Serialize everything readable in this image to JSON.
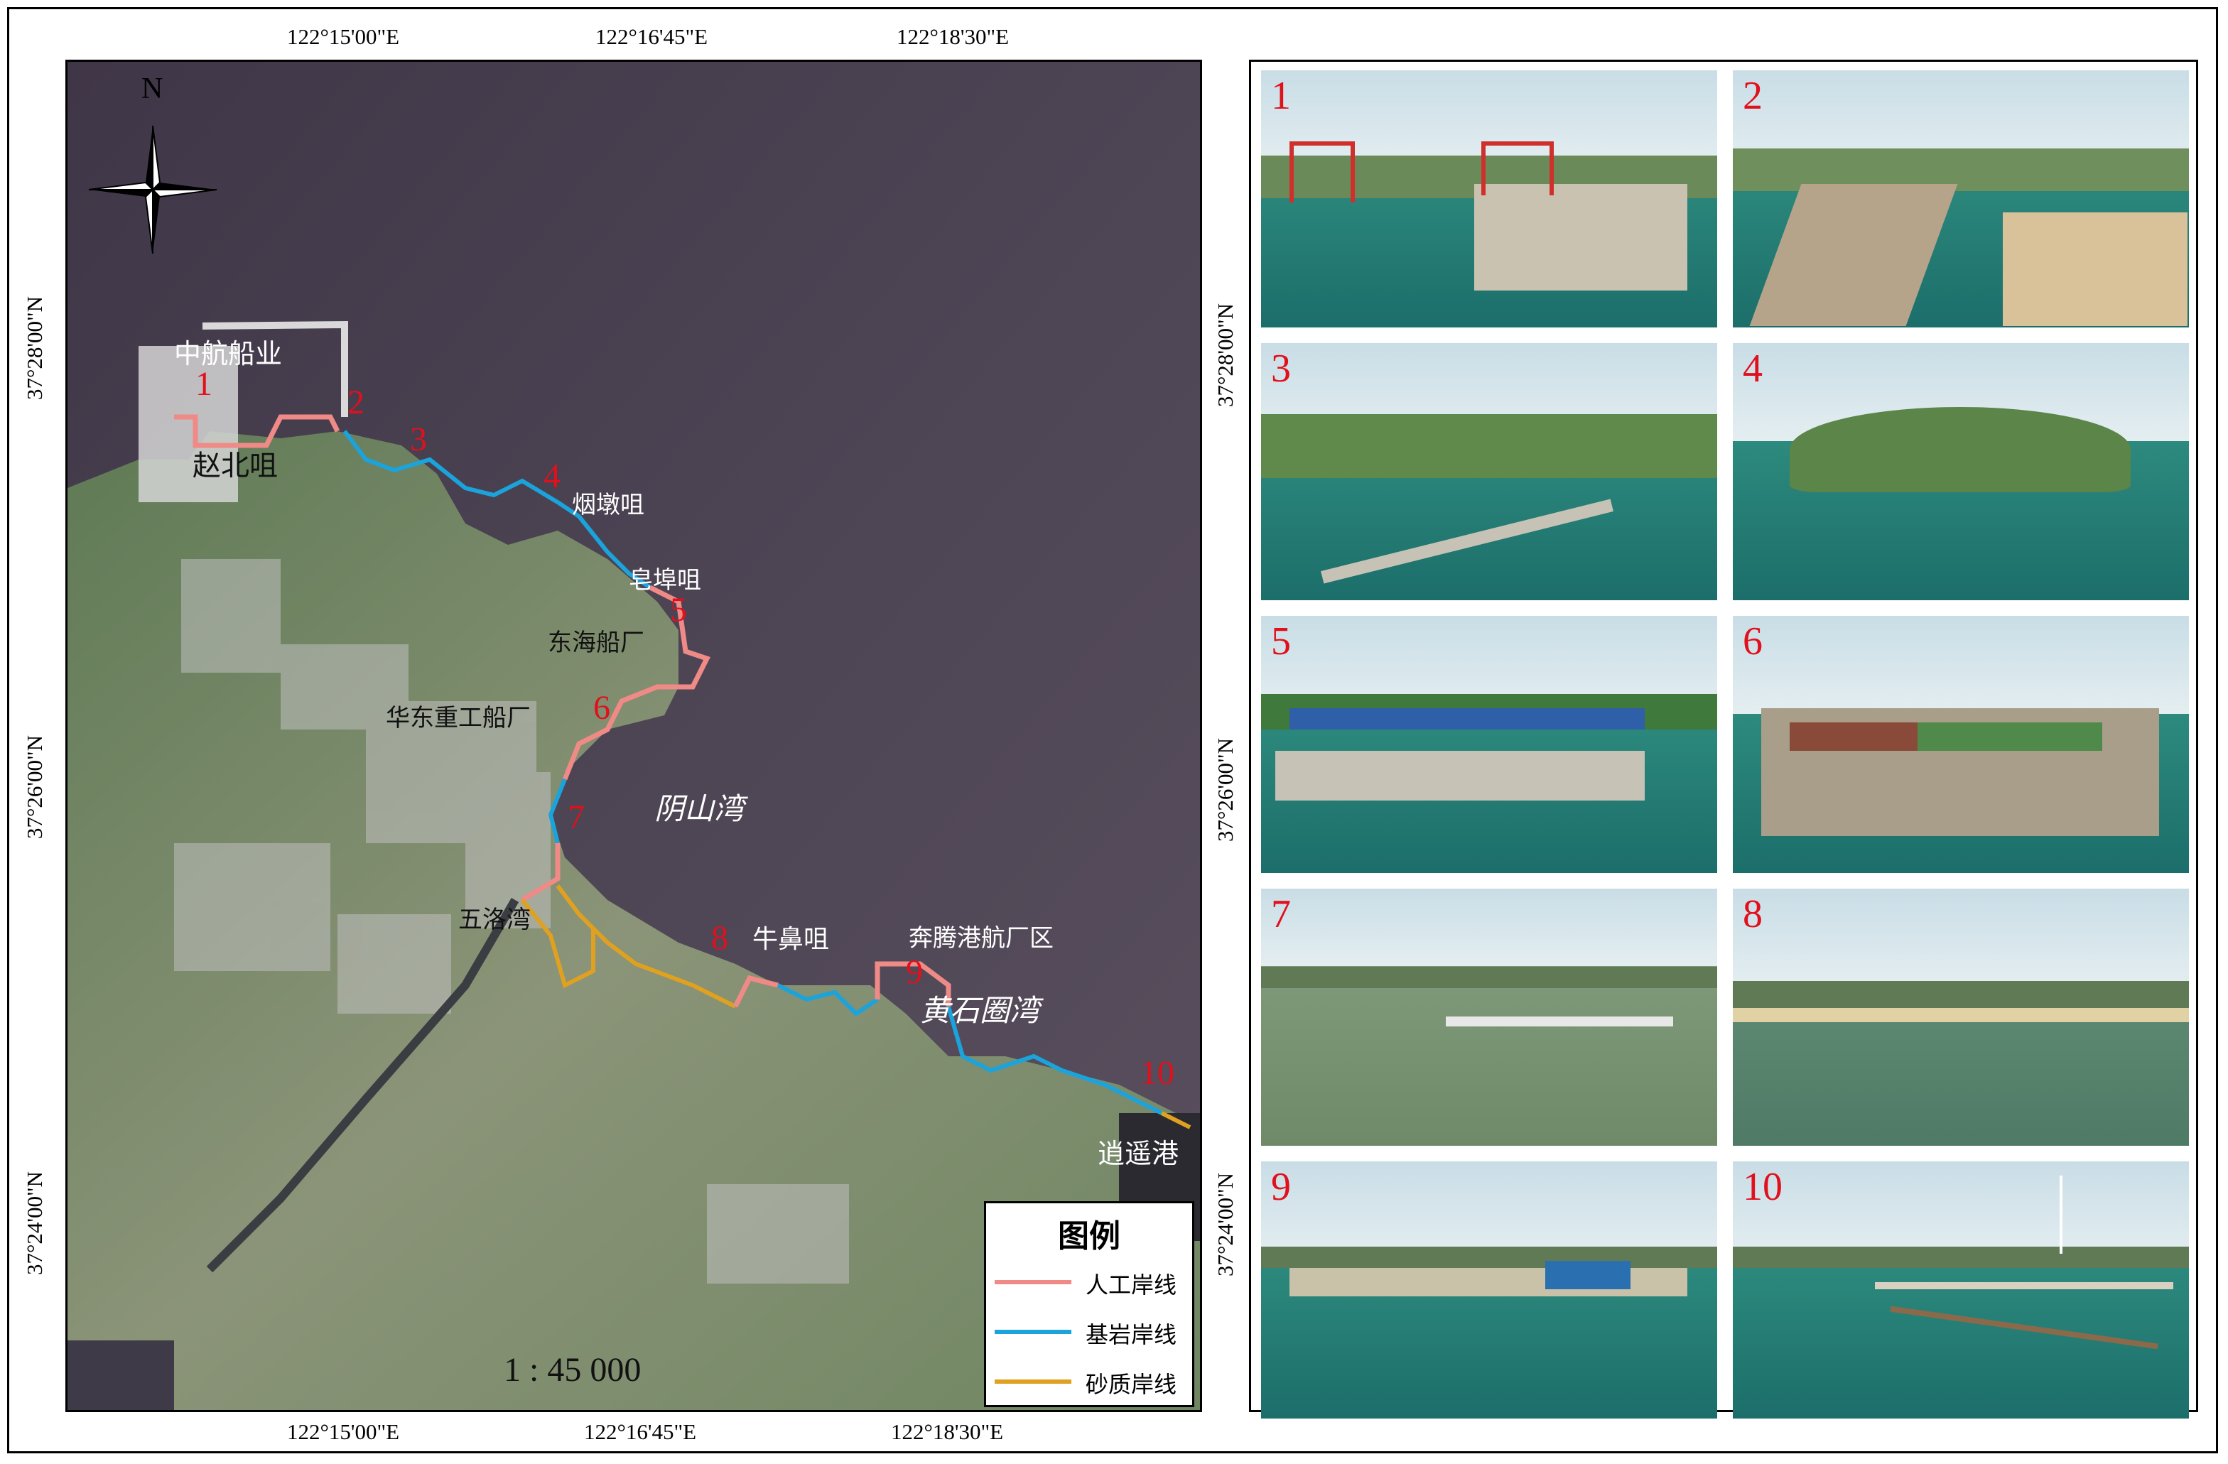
{
  "top_lon_labels": [
    "122°15'00\"E",
    "122°16'45\"E",
    "122°18'30\"E"
  ],
  "bottom_lon_labels": [
    "122°15'00\"E",
    "122°16'45\"E",
    "122°18'30\"E"
  ],
  "left_lat_labels": [
    "37°28'00\"N",
    "37°26'00\"N",
    "37°24'00\"N"
  ],
  "right_lat_labels": [
    "37°28'00\"N",
    "37°26'00\"N",
    "37°24'00\"N"
  ],
  "north_label": "N",
  "place_labels": {
    "zhonghang": "中航船业",
    "zhaobeizui": "赵北咀",
    "yandunzui": "烟墩咀",
    "huangbuzui": "皂埠咀",
    "donghai": "东海船厂",
    "huadong": "华东重工船厂",
    "yinshanwan": "阴山湾",
    "wulei": "五洛湾",
    "niubizui": "牛鼻咀",
    "benteng": "奔腾港航厂区",
    "huangshiquan": "黄石圈湾",
    "xiaoyao": "逍遥港"
  },
  "map_numbers": [
    "1",
    "2",
    "3",
    "4",
    "5",
    "6",
    "7",
    "8",
    "9",
    "10"
  ],
  "legend": {
    "title": "图例",
    "items": [
      {
        "label": "人工岸线",
        "color": "#f08a86"
      },
      {
        "label": "基岩岸线",
        "color": "#1ba3dc"
      },
      {
        "label": "砂质岸线",
        "color": "#e0a020"
      }
    ]
  },
  "scale": "1 : 45 000",
  "photo_numbers": [
    "1",
    "2",
    "3",
    "4",
    "5",
    "6",
    "7",
    "8",
    "9",
    "10"
  ]
}
